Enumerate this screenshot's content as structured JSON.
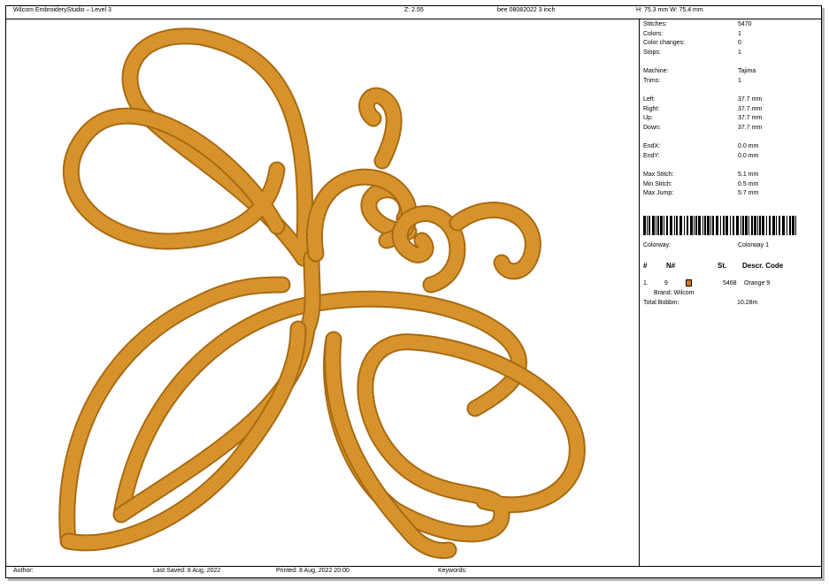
{
  "header": {
    "app_title": "Wilcom EmbroideryStudio – Level 3",
    "zoom": "Z: 2.55",
    "design": "bee 08082022 3 inch",
    "size": "H: 75.3 mm   W: 75.4 mm"
  },
  "stats": {
    "stitches": {
      "label": "Stitches:",
      "value": "5470"
    },
    "colors": {
      "label": "Colors:",
      "value": "1"
    },
    "color_changes": {
      "label": "Color changes:",
      "value": "0"
    },
    "stops": {
      "label": "Stops:",
      "value": "1"
    },
    "machine": {
      "label": "Machine:",
      "value": "Tajima"
    },
    "trims": {
      "label": "Trims:",
      "value": "1"
    },
    "left": {
      "label": "Left:",
      "value": "37.7 mm"
    },
    "right": {
      "label": "Right:",
      "value": "37.7 mm"
    },
    "up": {
      "label": "Up:",
      "value": "37.7 mm"
    },
    "down": {
      "label": "Down:",
      "value": "37.7 mm"
    },
    "endx": {
      "label": "EndX:",
      "value": "0.0 mm"
    },
    "endy": {
      "label": "EndY:",
      "value": "0.0 mm"
    },
    "max_stitch": {
      "label": "Max Stitch:",
      "value": "5.1 mm"
    },
    "min_stitch": {
      "label": "Min Stitch:",
      "value": "0.5 mm"
    },
    "max_jump": {
      "label": "Max Jump:",
      "value": "5.7 mm"
    }
  },
  "colorway": {
    "label": "Colorway:",
    "value": "Colorway 1"
  },
  "table": {
    "headers": [
      "#",
      "N#",
      "St.",
      "Descr. Code"
    ],
    "rows": [
      {
        "num": "1.",
        "n": "9",
        "swatch_color": "#d8741f",
        "stitches": "5468",
        "descr": "Orange 9",
        "brand": "Brand: Wilcom"
      }
    ]
  },
  "total_bobbin": {
    "label": "Total Bobbin:",
    "value": "10.28m"
  },
  "footer": {
    "author": "Author:",
    "last_saved": "Last Saved:  8 Aug, 2022",
    "printed": "Printed:  8 Aug, 2022 20:00",
    "keywords": "Keywords:"
  },
  "thread_color": "#d9952c",
  "thread_shadow": "#a86a12"
}
